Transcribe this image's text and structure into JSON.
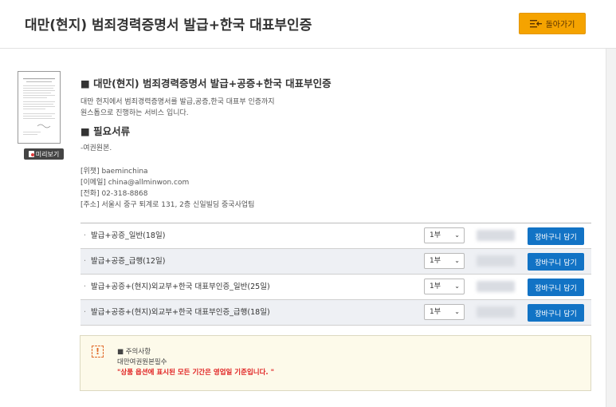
{
  "header": {
    "title": "대만(현지) 범죄경력증명서 발급+한국 대표부인증",
    "back_label": "돌아가기"
  },
  "preview": {
    "button_label": "미리보기"
  },
  "product": {
    "heading": "■ 대만(현지) 범죄경력증명서 발급+공증+한국 대표부인증",
    "desc_line1": "대만 현지에서 범죄경력증명서를 발급,공증,한국 대표부 인증까지",
    "desc_line2": "원스톱으로 진행하는 서비스 입니다.",
    "docs_heading": "■ 필요서류",
    "docs_item": "-여권원본.",
    "contact": {
      "wechat": "[위챗] baeminchina",
      "email": "[이메일] china@allminwon.com",
      "phone": "[전화] 02-318-8868",
      "address": "[주소] 서울시 중구 퇴계로 131, 2층 신일빌딩 중국사업팀"
    }
  },
  "options": [
    {
      "label": "발급+공증_일반(18일)",
      "qty": "1부",
      "cart": "장바구니 담기"
    },
    {
      "label": "발급+공증_급행(12일)",
      "qty": "1부",
      "cart": "장바구니 담기"
    },
    {
      "label": "발급+공증+(현지)외교부+한국 대표부인증_일반(25일)",
      "qty": "1부",
      "cart": "장바구니 담기"
    },
    {
      "label": "발급+공증+(현지)외교부+한국 대표부인증_급행(18일)",
      "qty": "1부",
      "cart": "장바구니 담기"
    }
  ],
  "notice": {
    "icon": "!",
    "title": "■ 주의사항",
    "line1": "대만여권원본필수",
    "line2": "\"상품 옵션에 표시된 모든 기간은 영업일 기준입니다. \""
  },
  "colors": {
    "accent": "#f5a300",
    "cart_button": "#1273c5",
    "notice_red": "#e02020"
  }
}
